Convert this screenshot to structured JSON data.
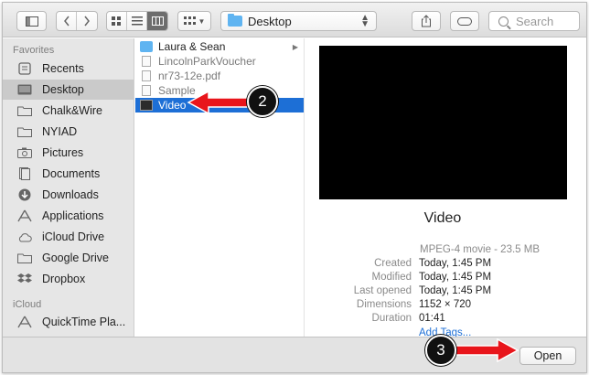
{
  "location": {
    "label": "Desktop"
  },
  "search": {
    "placeholder": "Search"
  },
  "sidebar": {
    "favorites_heading": "Favorites",
    "icloud_heading": "iCloud",
    "items": [
      {
        "label": "Recents",
        "icon": "recents-icon"
      },
      {
        "label": "Desktop",
        "icon": "desktop-icon",
        "selected": true
      },
      {
        "label": "Chalk&Wire",
        "icon": "folder-icon"
      },
      {
        "label": "NYIAD",
        "icon": "folder-icon"
      },
      {
        "label": "Pictures",
        "icon": "camera-icon"
      },
      {
        "label": "Documents",
        "icon": "documents-icon"
      },
      {
        "label": "Downloads",
        "icon": "download-icon"
      },
      {
        "label": "Applications",
        "icon": "applications-icon"
      },
      {
        "label": "iCloud Drive",
        "icon": "cloud-icon"
      },
      {
        "label": "Google Drive",
        "icon": "folder-icon"
      },
      {
        "label": "Dropbox",
        "icon": "dropbox-icon"
      }
    ],
    "icloud_items": [
      {
        "label": "QuickTime Pla...",
        "icon": "applications-icon"
      }
    ]
  },
  "files": [
    {
      "name": "Laura & Sean",
      "type": "folder",
      "dim": false
    },
    {
      "name": "LincolnParkVoucher",
      "type": "doc",
      "dim": true
    },
    {
      "name": "nr73-12e.pdf",
      "type": "doc",
      "dim": true
    },
    {
      "name": "Sample",
      "type": "doc",
      "dim": true
    },
    {
      "name": "Video",
      "type": "video",
      "selected": true
    }
  ],
  "preview": {
    "name": "Video",
    "kind": "MPEG-4 movie - 23.5 MB",
    "meta": [
      {
        "key": "Created",
        "value": "Today, 1:45 PM"
      },
      {
        "key": "Modified",
        "value": "Today, 1:45 PM"
      },
      {
        "key": "Last opened",
        "value": "Today, 1:45 PM"
      },
      {
        "key": "Dimensions",
        "value": "1152 × 720"
      },
      {
        "key": "Duration",
        "value": "01:41"
      }
    ],
    "add_tags": "Add Tags..."
  },
  "bottom": {
    "open_label": "Open"
  },
  "annotations": {
    "step2": "2",
    "step3": "3"
  },
  "colors": {
    "selection": "#1d6fd6",
    "arrow": "#e8151b",
    "badge": "#111111"
  }
}
